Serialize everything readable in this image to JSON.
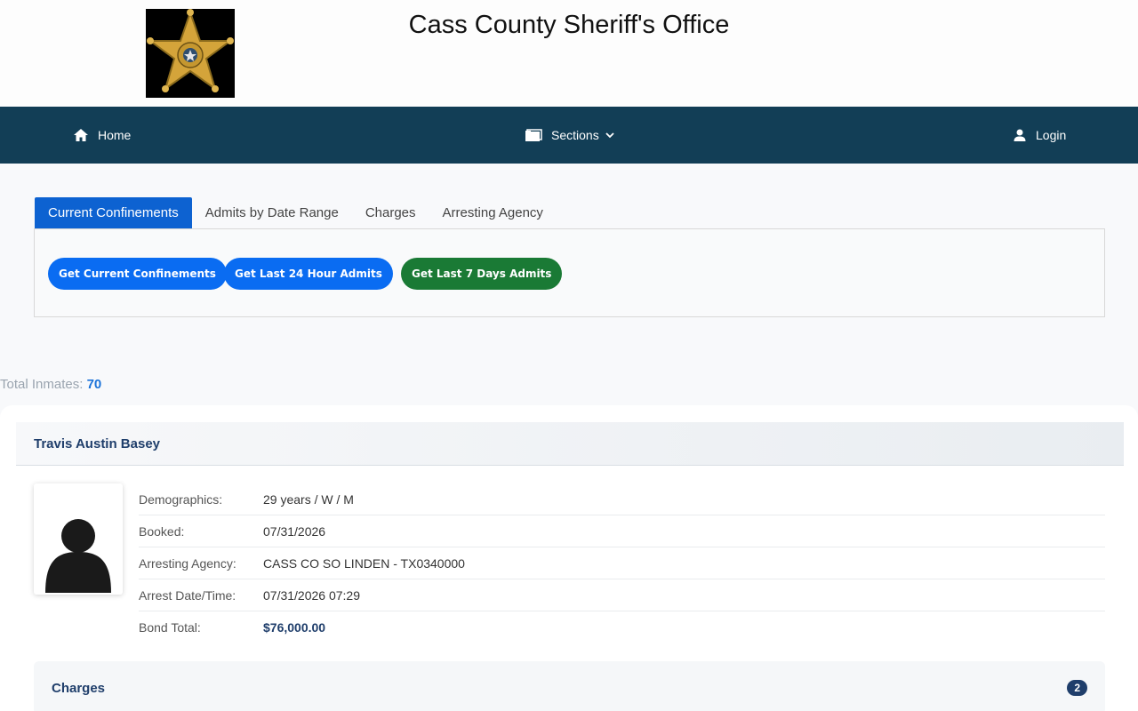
{
  "header": {
    "title": "Cass County Sheriff's Office",
    "logo_icon": "sheriff-star-badge"
  },
  "nav": {
    "home": "Home",
    "sections": "Sections",
    "login": "Login"
  },
  "tabs": [
    {
      "label": "Current Confinements",
      "active": true
    },
    {
      "label": "Admits by Date Range"
    },
    {
      "label": "Charges"
    },
    {
      "label": "Arresting Agency"
    }
  ],
  "buttons": {
    "current": "Get Current Confinements",
    "last24": "Get Last 24 Hour Admits",
    "last7": "Get Last 7 Days Admits"
  },
  "summary": {
    "label": "Total Inmates:",
    "count": "70"
  },
  "inmate": {
    "name": "Travis Austin Basey",
    "fields": [
      {
        "label": "Demographics:",
        "value": "29 years / W / M"
      },
      {
        "label": "Booked:",
        "value": "07/31/2026"
      },
      {
        "label": "Arresting Agency:",
        "value": "CASS CO SO LINDEN - TX0340000"
      },
      {
        "label": "Arrest Date/Time:",
        "value": "07/31/2026 07:29"
      },
      {
        "label": "Bond Total:",
        "value": "$76,000.00"
      }
    ],
    "charges_label": "Charges",
    "charges_count": "2"
  },
  "colors": {
    "nav_bg": "#123e56",
    "accent_blue": "#0a6cf2",
    "accent_green": "#1a7a35",
    "name_color": "#1f3e6b"
  }
}
